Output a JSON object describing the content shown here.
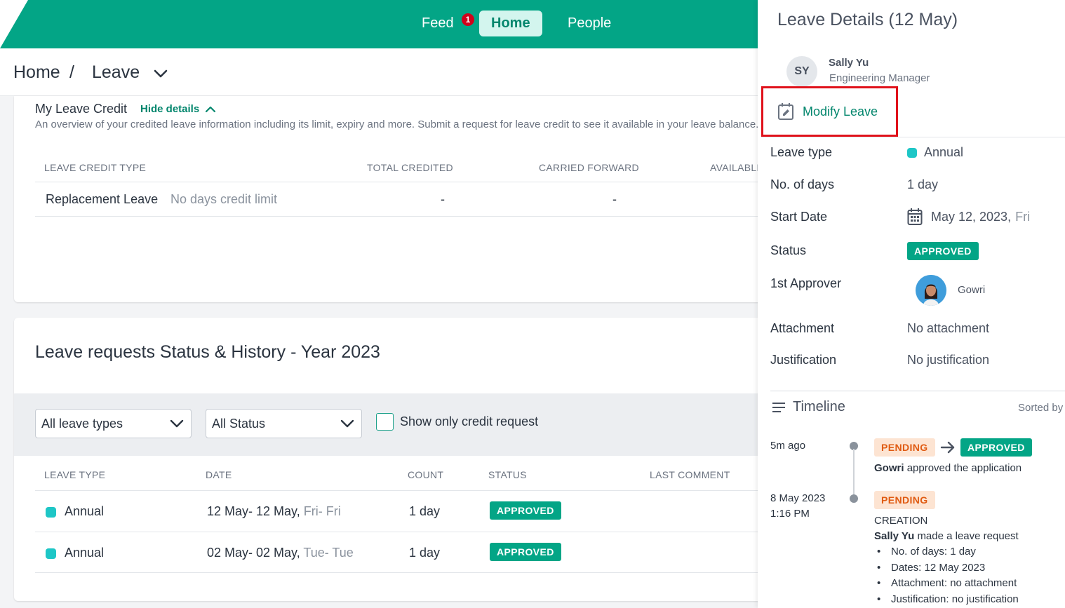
{
  "nav": {
    "feed": "Feed",
    "feed_badge": "1",
    "home": "Home",
    "people": "People"
  },
  "breadcrumb": {
    "home": "Home",
    "separator": "/",
    "current": "Leave"
  },
  "leave_credit": {
    "title": "My Leave Credit",
    "toggle": "Hide details",
    "description": "An overview of your credited leave information including its limit, expiry and more. Submit a request for leave credit to see it available in your leave balance.",
    "columns": [
      "LEAVE CREDIT TYPE",
      "TOTAL CREDITED",
      "CARRIED FORWARD",
      "AVAILABLE"
    ],
    "rows": [
      {
        "type": "Replacement Leave",
        "note": "No days credit limit",
        "total": "-",
        "carried": "-"
      }
    ]
  },
  "requests": {
    "title": "Leave requests Status & History - Year 2023",
    "filter_type": "All leave types",
    "filter_status": "All Status",
    "credit_only_label": "Show only credit request",
    "columns": [
      "LEAVE TYPE",
      "DATE",
      "COUNT",
      "STATUS",
      "LAST COMMENT"
    ],
    "rows": [
      {
        "type": "Annual",
        "date": "12 May- 12 May,",
        "days": "Fri- Fri",
        "count": "1 day",
        "status": "APPROVED"
      },
      {
        "type": "Annual",
        "date": "02 May- 02 May,",
        "days": "Tue- Tue",
        "count": "1 day",
        "status": "APPROVED"
      }
    ]
  },
  "panel": {
    "title": "Leave Details (12 May)",
    "initials": "SY",
    "name": "Sally Yu",
    "role": "Engineering Manager",
    "modify_label": "Modify Leave",
    "fields": {
      "leave_type_label": "Leave type",
      "leave_type": "Annual",
      "days_label": "No. of days",
      "days": "1 day",
      "start_label": "Start Date",
      "start_date": "May 12, 2023,",
      "start_day": "Fri",
      "status_label": "Status",
      "status": "APPROVED",
      "approver_label": "1st Approver",
      "approver": "Gowri",
      "attachment_label": "Attachment",
      "attachment": "No attachment",
      "justification_label": "Justification",
      "justification": "No justification"
    },
    "timeline": {
      "title": "Timeline",
      "sort": "Sorted by",
      "entries": [
        {
          "time": "5m ago",
          "from": "PENDING",
          "to": "APPROVED",
          "actor": "Gowri",
          "text": "approved the application"
        },
        {
          "time_date": "8 May 2023",
          "time_clock": "1:16 PM",
          "status": "PENDING",
          "event": "CREATION",
          "actor": "Sally Yu",
          "text": "made a leave request",
          "details": [
            "No. of days: 1 day",
            "Dates: 12 May 2023",
            "Attachment: no attachment",
            "Justification: no justification"
          ]
        }
      ]
    }
  },
  "colors": {
    "brand": "#03a586",
    "accent_text": "#03866d",
    "annual_dot": "#1ec6c6",
    "pending_bg": "#fde4d2",
    "pending_text": "#e05b12",
    "highlight": "#e0121b"
  }
}
